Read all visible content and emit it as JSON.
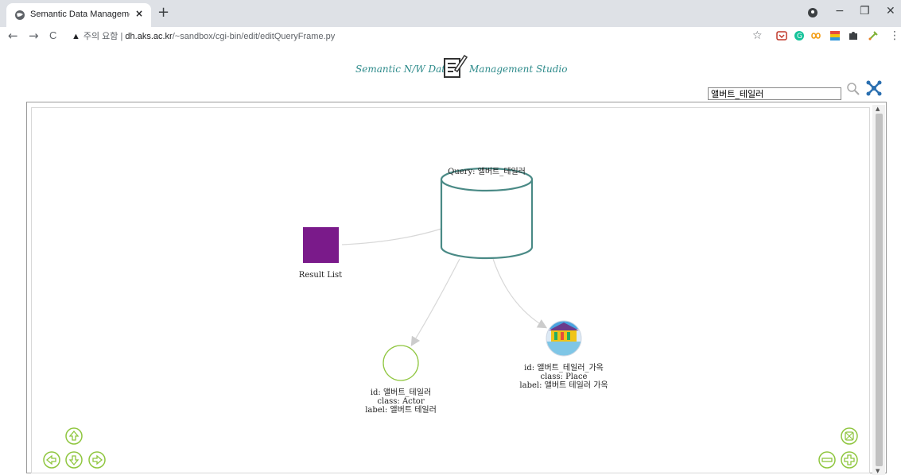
{
  "browser": {
    "tab_title": "Semantic Data Management St",
    "tab_close": "×",
    "new_tab": "+",
    "win_minimize": "−",
    "win_maximize": "❐",
    "win_close": "✕",
    "nav_back": "←",
    "nav_forward": "→",
    "nav_reload": "C",
    "security_label": "주의 요함",
    "url_host": "dh.aks.ac.kr",
    "url_path": "/~sandbox/cgi-bin/edit/editQueryFrame.py",
    "bookmark_icon": "☆",
    "menu_icon": "⋮",
    "extensions": [
      "pocket-icon",
      "grammarly-icon",
      "infinity-icon",
      "color-palette-icon",
      "puzzle-icon",
      "eyedropper-icon"
    ]
  },
  "header": {
    "title_left": "Semantic N/W Data",
    "title_right": "Management Studio",
    "logo_icon": "edit-note-icon"
  },
  "search": {
    "value": "앨버트_테일러",
    "search_icon": "magnifier-icon",
    "network_icon": "network-icon"
  },
  "graph": {
    "query_node": {
      "label": "Query: 앨버트_테일러",
      "color": "#4a8a86"
    },
    "result_node": {
      "label": "Result List",
      "color": "#7a1a8a"
    },
    "actor_node": {
      "line1": "id: 앨버트_테일러",
      "line2": "class: Actor",
      "line3": "label: 앨버트 테일러",
      "color": "#8fc63f"
    },
    "place_node": {
      "line1": "id: 앨버트_테일러_가옥",
      "line2": "class: Place",
      "line3": "label: 앨버트 테일러 가옥"
    }
  },
  "controls": {
    "pan_up": "pan-up-icon",
    "pan_left": "pan-left-icon",
    "pan_down": "pan-down-icon",
    "pan_right": "pan-right-icon",
    "zoom_fit": "zoom-fit-icon",
    "zoom_out": "zoom-out-icon",
    "zoom_in": "zoom-in-icon",
    "color": "#8fc63f"
  }
}
